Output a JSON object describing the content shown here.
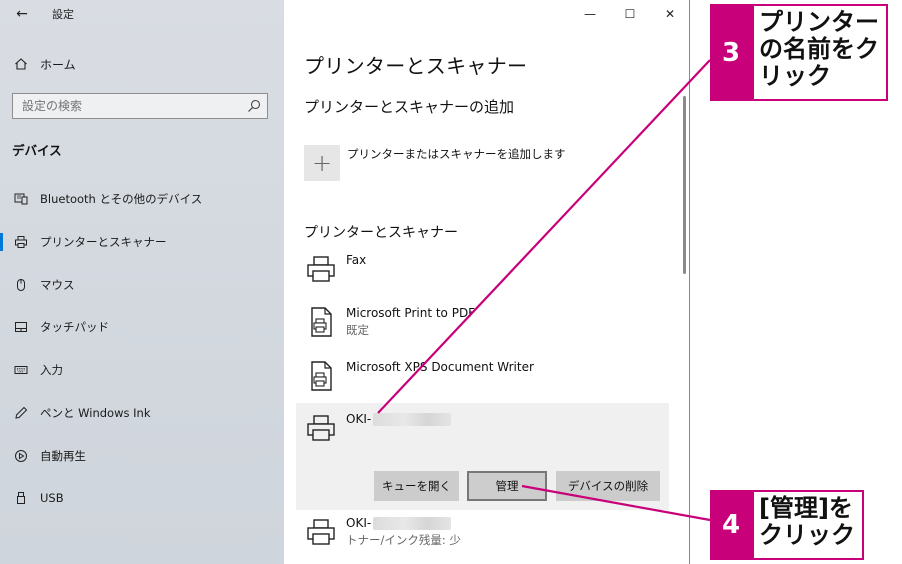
{
  "window": {
    "title": "設定",
    "back_glyph": "←",
    "controls": {
      "minimize": "—",
      "maximize": "☐",
      "close": "✕"
    }
  },
  "sidebar": {
    "home_label": "ホーム",
    "search_placeholder": "設定の検索",
    "section_label": "デバイス",
    "items": [
      {
        "label": "Bluetooth とその他のデバイス",
        "icon": "bluetooth-devices-icon"
      },
      {
        "label": "プリンターとスキャナー",
        "icon": "printer-icon"
      },
      {
        "label": "マウス",
        "icon": "mouse-icon"
      },
      {
        "label": "タッチパッド",
        "icon": "touchpad-icon"
      },
      {
        "label": "入力",
        "icon": "keyboard-icon"
      },
      {
        "label": "ペンと Windows Ink",
        "icon": "pen-icon"
      },
      {
        "label": "自動再生",
        "icon": "autoplay-icon"
      },
      {
        "label": "USB",
        "icon": "usb-icon"
      }
    ],
    "active_item": "プリンターとスキャナー"
  },
  "main": {
    "page_title": "プリンターとスキャナー",
    "add_section_title": "プリンターとスキャナーの追加",
    "add_button_glyph": "+",
    "add_button_label": "プリンターまたはスキャナーを追加します",
    "list_title": "プリンターとスキャナー",
    "printers": [
      {
        "name": "Fax",
        "status": ""
      },
      {
        "name": "Microsoft Print to PDF",
        "status": "既定"
      },
      {
        "name": "Microsoft XPS Document Writer",
        "status": ""
      },
      {
        "name": "OKI-",
        "status": ""
      },
      {
        "name": "OKI-",
        "status": "トナー/インク残量: 少"
      }
    ],
    "selected_actions": {
      "open_queue": "キューを開く",
      "manage": "管理",
      "remove_device": "デバイスの削除"
    }
  },
  "annotations": [
    {
      "number": "3",
      "text_lines": [
        "プリンター",
        "の名前をク",
        "リック"
      ]
    },
    {
      "number": "4",
      "text_lines": [
        "[管理]を",
        "クリック"
      ]
    }
  ],
  "colors": {
    "accent": "#c8007a",
    "sidebar_bg": "#d6dbe1",
    "selected_bg": "#f0f0f0",
    "button_bg": "#cccccc"
  }
}
